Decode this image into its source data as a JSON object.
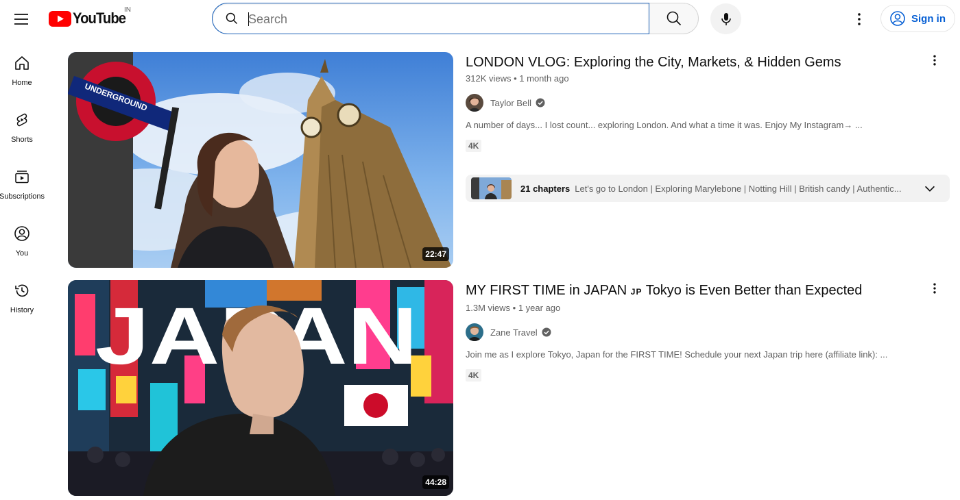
{
  "header": {
    "logo_text": "YouTube",
    "country_code": "IN",
    "search_placeholder": "Search",
    "sign_in_label": "Sign in"
  },
  "sidebar": {
    "items": [
      {
        "label": "Home",
        "icon": "home-icon"
      },
      {
        "label": "Shorts",
        "icon": "shorts-icon"
      },
      {
        "label": "Subscriptions",
        "icon": "subscriptions-icon"
      },
      {
        "label": "You",
        "icon": "you-icon"
      },
      {
        "label": "History",
        "icon": "history-icon"
      }
    ]
  },
  "results": [
    {
      "title": "LONDON VLOG: Exploring the City, Markets, & Hidden Gems",
      "views": "312K views",
      "age": "1 month ago",
      "channel": "Taylor Bell",
      "description": "A number of days... I lost count... exploring London. And what a time it was. Enjoy My Instagram→ ...",
      "badge": "4K",
      "duration": "22:47",
      "chapters_count": "21 chapters",
      "chapters_text": "Let's go to London | Exploring Marylebone | Notting Hill | British candy | Authentic..."
    },
    {
      "title_pre": "MY FIRST TIME in JAPAN",
      "title_flag": "JP",
      "title_post": "Tokyo is Even Better than Expected",
      "views": "1.3M views",
      "age": "1 year ago",
      "channel": "Zane Travel",
      "description": "Join me as I explore Tokyo, Japan for the FIRST TIME! Schedule your next Japan trip here (affiliate link): ...",
      "badge": "4K",
      "duration": "44:28",
      "thumb_text": "JAPAN"
    }
  ],
  "colors": {
    "brand_red": "#ff0000",
    "link_blue": "#065fd4",
    "search_focus": "#1c62b9",
    "secondary_text": "#606060"
  }
}
